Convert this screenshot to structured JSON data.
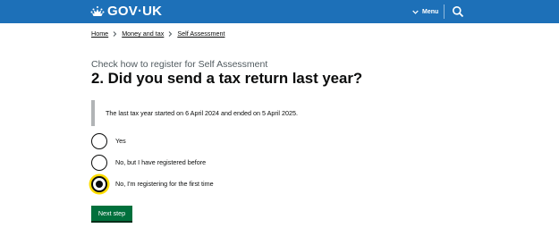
{
  "header": {
    "logo_text": "GOV·UK",
    "menu_label": "Menu",
    "colors": {
      "background": "#1d70b8",
      "text": "#ffffff"
    }
  },
  "breadcrumbs": [
    {
      "label": "Home"
    },
    {
      "label": "Money and tax"
    },
    {
      "label": "Self Assessment"
    }
  ],
  "question": {
    "caption": "Check how to register for Self Assessment",
    "heading": "2. Did you send a tax return last year?",
    "inset_text": "The last tax year started on 6 April 2024 and ended on 5 April 2025."
  },
  "options": [
    {
      "label": "Yes",
      "selected": false
    },
    {
      "label": "No, but I have registered before",
      "selected": false
    },
    {
      "label": "No, I'm registering for the first time",
      "selected": true
    }
  ],
  "actions": {
    "next_label": "Next step",
    "button_color": "#00703c",
    "focus_color": "#ffdd00"
  },
  "icons": [
    "crown-icon",
    "chevron-down-icon",
    "search-icon",
    "chevron-right-icon"
  ]
}
